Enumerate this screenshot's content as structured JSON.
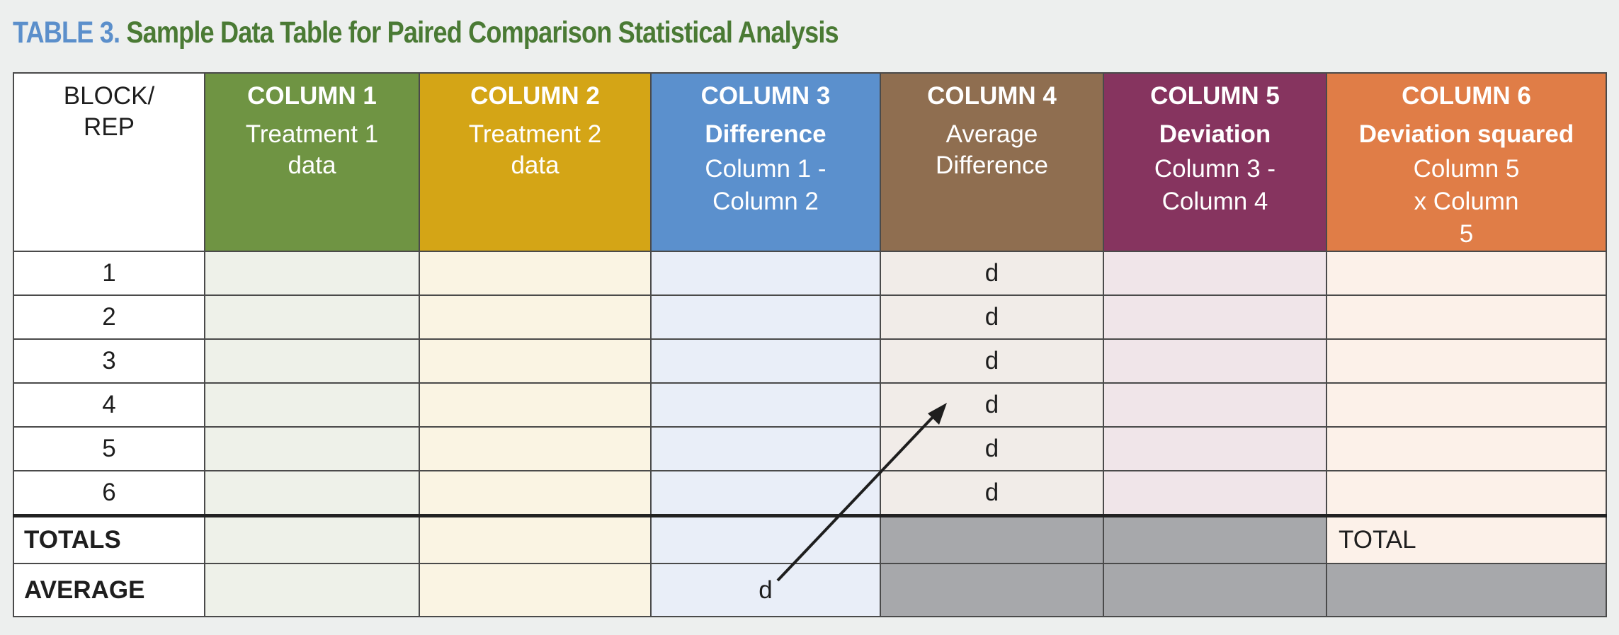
{
  "title": {
    "number": "TABLE 3.",
    "text": "Sample Data Table for Paired Comparison Statistical Analysis"
  },
  "colors": {
    "title_number": "#5b8fcb",
    "title_text": "#4a7a34",
    "col1": "#6f9443",
    "col2": "#d4a516",
    "col3": "#5b90cd",
    "col4": "#8f6e50",
    "col5": "#86345f",
    "col6": "#e07d47",
    "disabled_cell": "#a7a8ab"
  },
  "header": {
    "col0": {
      "line1": "BLOCK/",
      "line2": "REP"
    },
    "columns": [
      {
        "title": "COLUMN 1",
        "subtitle": "Treatment 1 data",
        "formula": ""
      },
      {
        "title": "COLUMN 2",
        "subtitle": "Treatment 2 data",
        "formula": ""
      },
      {
        "title": "COLUMN 3",
        "subtitle": "Difference",
        "formula": "Column 1 - Column 2"
      },
      {
        "title": "COLUMN 4",
        "subtitle": "Average Difference",
        "formula": ""
      },
      {
        "title": "COLUMN 5",
        "subtitle": "Deviation",
        "formula": "Column 3 - Column 4"
      },
      {
        "title": "COLUMN 6",
        "subtitle": "Deviation squared",
        "formula": "Column 5 x Column 5"
      }
    ]
  },
  "rows": [
    {
      "label": "1",
      "cells": [
        "",
        "",
        "",
        "d",
        "",
        ""
      ]
    },
    {
      "label": "2",
      "cells": [
        "",
        "",
        "",
        "d",
        "",
        ""
      ]
    },
    {
      "label": "3",
      "cells": [
        "",
        "",
        "",
        "d",
        "",
        ""
      ]
    },
    {
      "label": "4",
      "cells": [
        "",
        "",
        "",
        "d",
        "",
        ""
      ]
    },
    {
      "label": "5",
      "cells": [
        "",
        "",
        "",
        "d",
        "",
        ""
      ]
    },
    {
      "label": "6",
      "cells": [
        "",
        "",
        "",
        "d",
        "",
        ""
      ]
    }
  ],
  "totals": {
    "label": "TOTALS",
    "cells": [
      "",
      "",
      "",
      "",
      "",
      "TOTAL"
    ]
  },
  "average": {
    "label": "AVERAGE",
    "cells": [
      "",
      "",
      "d",
      "",
      "",
      ""
    ]
  },
  "annotation": {
    "type": "arrow",
    "from": "average column 3 (d)",
    "to": "column 4 rows"
  }
}
